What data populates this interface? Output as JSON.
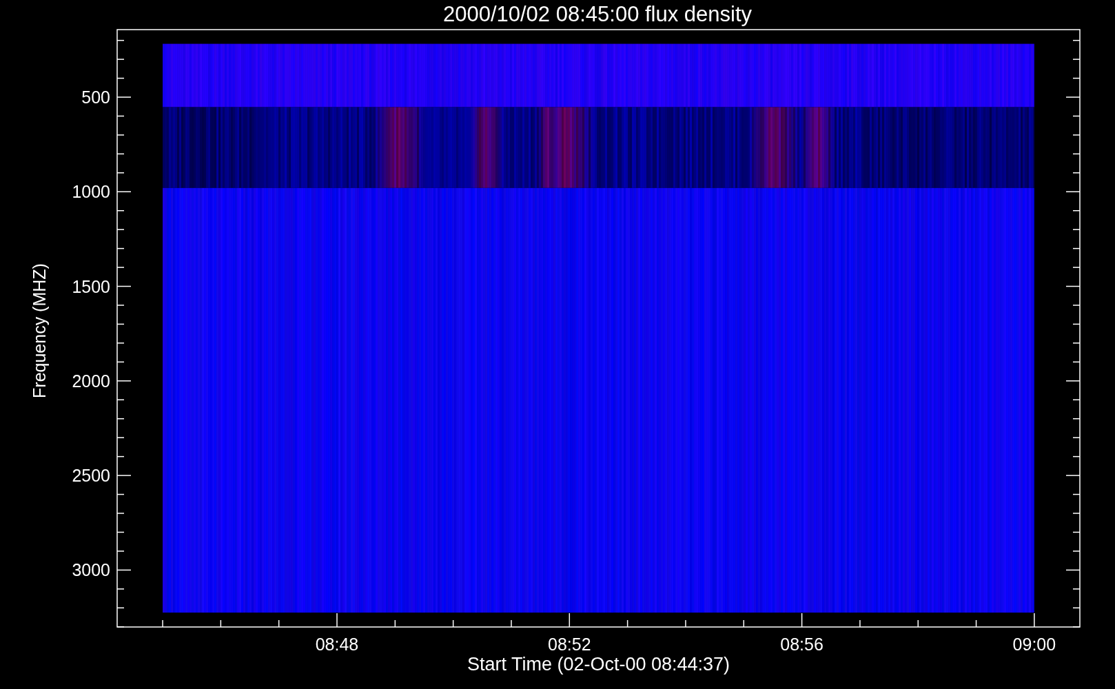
{
  "title": "2000/10/02 08:45:00 flux density",
  "y_axis": {
    "label": "Frequency (MHZ)",
    "ticks": [
      "500",
      "1000",
      "1500",
      "2000",
      "2500",
      "3000"
    ]
  },
  "x_axis": {
    "label": "Start Time (02-Oct-00 08:44:37)",
    "ticks": [
      "08:48",
      "08:52",
      "08:56",
      "09:00"
    ]
  }
}
